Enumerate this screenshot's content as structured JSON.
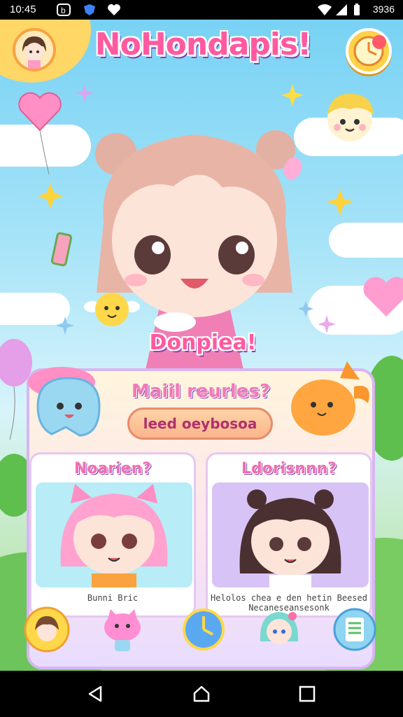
{
  "status_bar": {
    "time": "10:45",
    "battery_text": "3936",
    "icons": [
      "b-icon",
      "shield-icon",
      "heart-icon",
      "wifi-icon",
      "signal-icon",
      "battery-icon"
    ]
  },
  "header": {
    "title": "NoHondapis!",
    "avatar_icon": "player-avatar",
    "corner_icon": "timer-icon"
  },
  "hero": {
    "caption": "Donpiea!"
  },
  "panel": {
    "title": "Maiil reurles?",
    "button_label": "leed oeybosoa",
    "cards": [
      {
        "title": "Noarien?",
        "caption_lines": [
          "Bunni Bric"
        ],
        "bg": "#b8ecf6"
      },
      {
        "title": "Ldorisnnn?",
        "caption_lines": [
          "Helolos chea e den hetin Beesed",
          "Necaneseansesonk"
        ],
        "bg": "#d8c3f6"
      }
    ]
  },
  "bottom_bar": {
    "icons": [
      "friend-avatar-icon",
      "pink-cat-icon",
      "clock-icon",
      "blue-girl-icon",
      "notepad-icon"
    ]
  },
  "colors": {
    "accent_pink": "#ff5aa0",
    "outline_purple": "#7c3fb0",
    "sun_yellow": "#ffd766"
  }
}
